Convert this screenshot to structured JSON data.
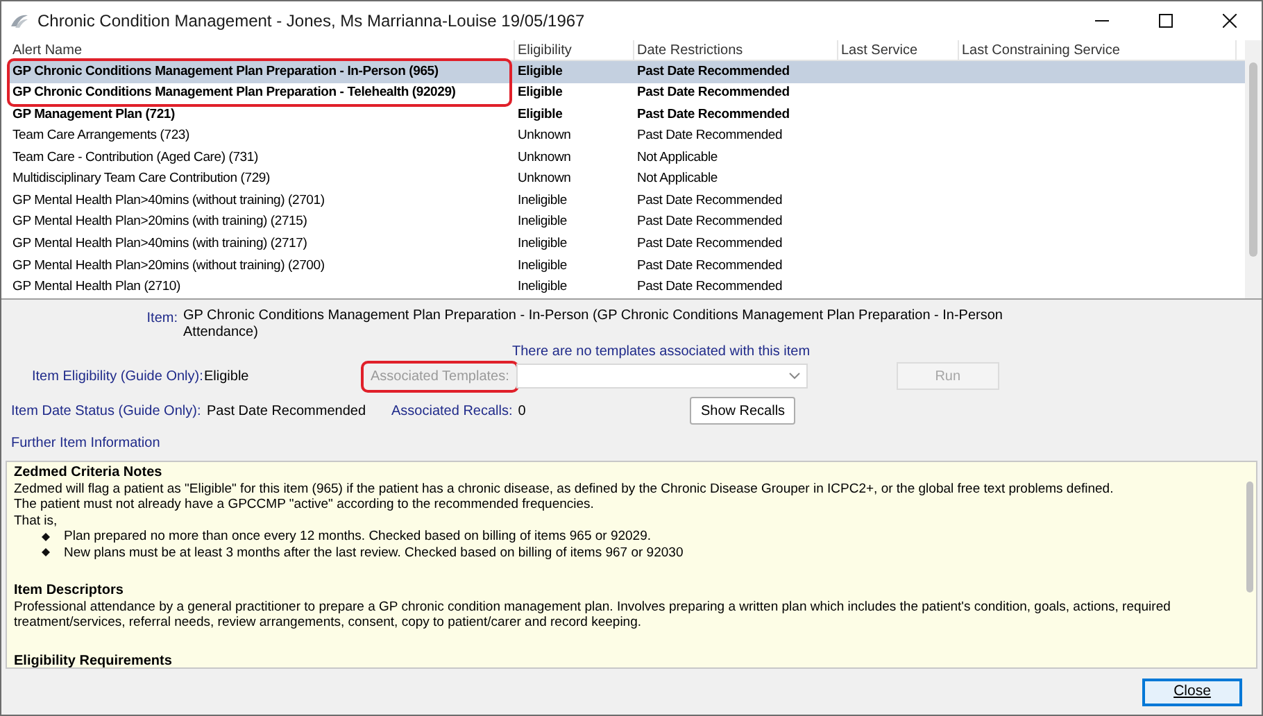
{
  "window": {
    "title": "Chronic Condition Management - Jones, Ms Marrianna-Louise 19/05/1967"
  },
  "table": {
    "columns": [
      "Alert Name",
      "Eligibility",
      "Date Restrictions",
      "Last Service",
      "Last Constraining Service"
    ],
    "rows": [
      {
        "name": "GP Chronic Conditions Management Plan Preparation - In-Person (965)",
        "eligibility": "Eligible",
        "date_restrictions": "Past Date Recommended",
        "bold": true,
        "selected": true,
        "outlined": true
      },
      {
        "name": "GP Chronic Conditions Management Plan Preparation - Telehealth (92029)",
        "eligibility": "Eligible",
        "date_restrictions": "Past Date Recommended",
        "bold": true,
        "selected": false,
        "outlined": true
      },
      {
        "name": "GP Management Plan (721)",
        "eligibility": "Eligible",
        "date_restrictions": "Past Date Recommended",
        "bold": true,
        "selected": false,
        "outlined": false
      },
      {
        "name": "Team Care Arrangements (723)",
        "eligibility": "Unknown",
        "date_restrictions": "Past Date Recommended",
        "bold": false,
        "selected": false,
        "outlined": false
      },
      {
        "name": "Team Care - Contribution (Aged Care) (731)",
        "eligibility": "Unknown",
        "date_restrictions": "Not Applicable",
        "bold": false,
        "selected": false,
        "outlined": false
      },
      {
        "name": "Multidisciplinary Team Care Contribution (729)",
        "eligibility": "Unknown",
        "date_restrictions": "Not Applicable",
        "bold": false,
        "selected": false,
        "outlined": false
      },
      {
        "name": "GP Mental Health Plan>40mins (without training) (2701)",
        "eligibility": "Ineligible",
        "date_restrictions": "Past Date Recommended",
        "bold": false,
        "selected": false,
        "outlined": false
      },
      {
        "name": "GP Mental Health Plan>20mins (with training) (2715)",
        "eligibility": "Ineligible",
        "date_restrictions": "Past Date Recommended",
        "bold": false,
        "selected": false,
        "outlined": false
      },
      {
        "name": "GP Mental Health Plan>40mins (with training) (2717)",
        "eligibility": "Ineligible",
        "date_restrictions": "Past Date Recommended",
        "bold": false,
        "selected": false,
        "outlined": false
      },
      {
        "name": "GP Mental Health Plan>20mins (without training) (2700)",
        "eligibility": "Ineligible",
        "date_restrictions": "Past Date Recommended",
        "bold": false,
        "selected": false,
        "outlined": false
      },
      {
        "name": "GP Mental Health Plan (2710)",
        "eligibility": "Ineligible",
        "date_restrictions": "Past Date Recommended",
        "bold": false,
        "selected": false,
        "outlined": false
      }
    ]
  },
  "details": {
    "item_label": "Item:",
    "item_value": "GP Chronic Conditions Management Plan Preparation - In-Person (GP Chronic Conditions Management Plan Preparation - In-Person Attendance)",
    "templates_note": "There are no templates associated with this item",
    "eligibility_label": "Item Eligibility (Guide Only):",
    "eligibility_value": "Eligible",
    "templates_label": "Associated Templates:",
    "templates_outlined": true,
    "run_button": {
      "label": "Run",
      "disabled": true
    },
    "date_status_label": "Item Date Status (Guide Only):",
    "date_status_value": "Past Date Recommended",
    "recalls_label": "Associated Recalls:",
    "recalls_value": "0",
    "show_recalls_button": "Show Recalls",
    "further_info_label": "Further Item Information"
  },
  "info": [
    {
      "heading": "Zedmed Criteria Notes",
      "paragraphs": [
        "Zedmed will flag a patient as \"Eligible\" for this item (965) if the patient has a chronic disease, as defined by the Chronic Disease Grouper in ICPC2+, or the global free text problems defined.",
        "The patient must not already have a GPCCMP \"active\" according to the recommended frequencies.",
        "That is,"
      ],
      "bullets": [
        "Plan prepared no more than once every 12 months. Checked based on billing of items 965 or 92029.",
        "New plans must be at least 3 months after the last review. Checked based on billing of items 967 or 92030"
      ]
    },
    {
      "heading": "Item Descriptors",
      "paragraphs": [
        "Professional attendance by a general practitioner to prepare a GP chronic condition management plan. Involves preparing a written plan which includes the patient's condition, goals, actions, required treatment/services, referral needs, review arrangements, consent, copy to patient/carer and record keeping."
      ]
    },
    {
      "heading": "Eligibility Requirements"
    }
  ],
  "close_button": "Close"
}
